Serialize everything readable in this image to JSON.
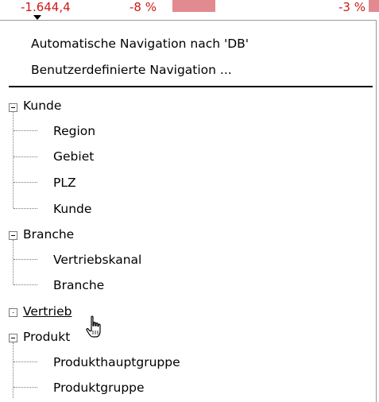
{
  "strip": {
    "value_1": "-1.644,4",
    "value_2": "-8 %",
    "value_3": "-3 %",
    "bar_color": "#e28a90"
  },
  "menu": {
    "actions": [
      "Automatische Navigation nach 'DB'",
      "Benutzerdefinierte Navigation ..."
    ],
    "tree": [
      {
        "label": "Kunde",
        "state": "expanded",
        "children": [
          "Region",
          "Gebiet",
          "PLZ",
          "Kunde"
        ]
      },
      {
        "label": "Branche",
        "state": "expanded",
        "children": [
          "Vertriebskanal",
          "Branche"
        ]
      },
      {
        "label": "Vertrieb",
        "state": "collapsed",
        "hovered": true,
        "children": []
      },
      {
        "label": "Produkt",
        "state": "expanded",
        "children": [
          "Produkthauptgruppe",
          "Produktgruppe"
        ]
      }
    ]
  },
  "icons": {
    "cursor": "hand-pointer-icon",
    "expanded": "minus-box-icon",
    "collapsed": "dot-box-icon",
    "dropdown": "triangle-down-icon"
  }
}
